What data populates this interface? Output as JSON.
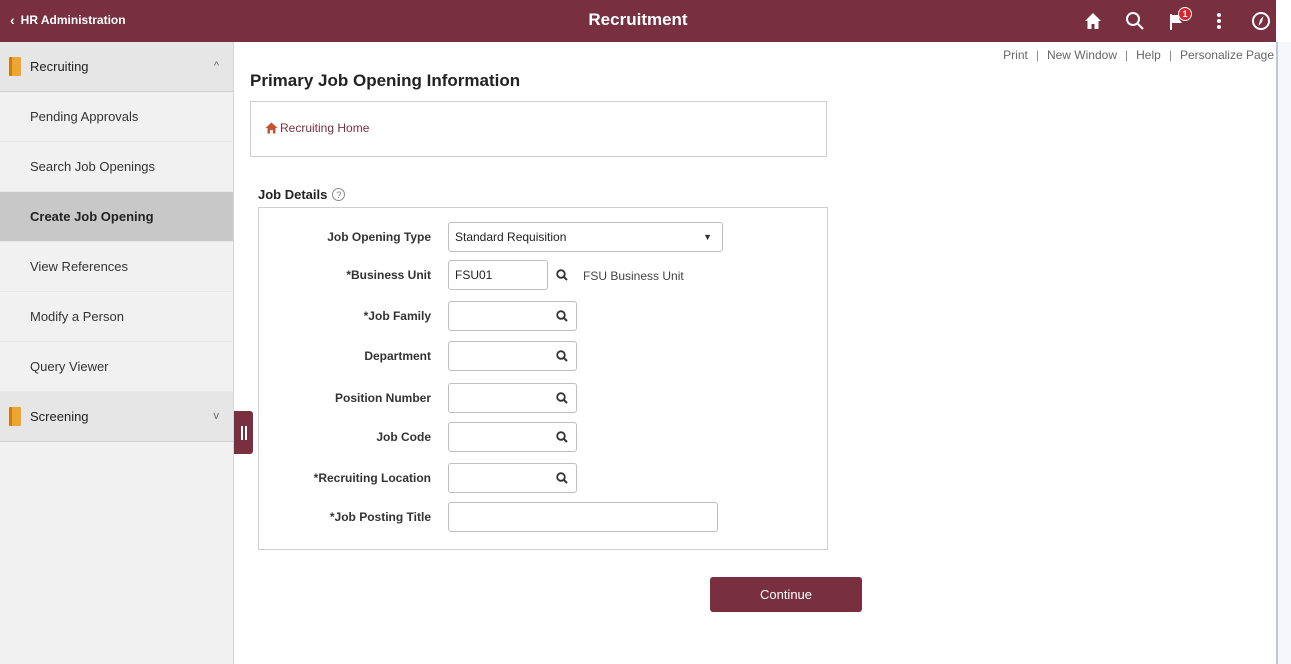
{
  "header": {
    "back_label": "HR Administration",
    "title": "Recruitment",
    "notification_count": "1",
    "icons": [
      "home-icon",
      "search-icon",
      "flag-icon",
      "more-vertical-icon",
      "navigator-icon"
    ],
    "accent_color": "#782f40"
  },
  "sidebar": {
    "sections": [
      {
        "label": "Recruiting",
        "expanded": true
      },
      {
        "label": "Screening",
        "expanded": false
      }
    ],
    "items": [
      {
        "label": "Pending Approvals"
      },
      {
        "label": "Search Job Openings"
      },
      {
        "label": "Create Job Opening",
        "active": true
      },
      {
        "label": "View References"
      },
      {
        "label": "Modify a Person"
      },
      {
        "label": "Query Viewer"
      }
    ]
  },
  "page_links": {
    "print": "Print",
    "new_window": "New Window",
    "help": "Help",
    "personalize": "Personalize Page"
  },
  "main": {
    "title": "Primary Job Opening Information",
    "home_link": "Recruiting Home",
    "section_title": "Job Details",
    "help_glyph": "?",
    "fields": [
      {
        "label": "Job Opening Type",
        "value": "Standard Requisition",
        "kind": "select"
      },
      {
        "label": "*Business Unit",
        "value": "FSU01",
        "kind": "lookup",
        "description": "FSU Business Unit"
      },
      {
        "label": "*Job Family",
        "value": "",
        "kind": "lookup"
      },
      {
        "label": "Department",
        "value": "",
        "kind": "lookup"
      },
      {
        "label": "Position Number",
        "value": "",
        "kind": "lookup"
      },
      {
        "label": "Job Code",
        "value": "",
        "kind": "lookup"
      },
      {
        "label": "*Recruiting Location",
        "value": "",
        "kind": "lookup"
      },
      {
        "label": "*Job Posting Title",
        "value": "",
        "kind": "text"
      }
    ],
    "continue_label": "Continue"
  }
}
